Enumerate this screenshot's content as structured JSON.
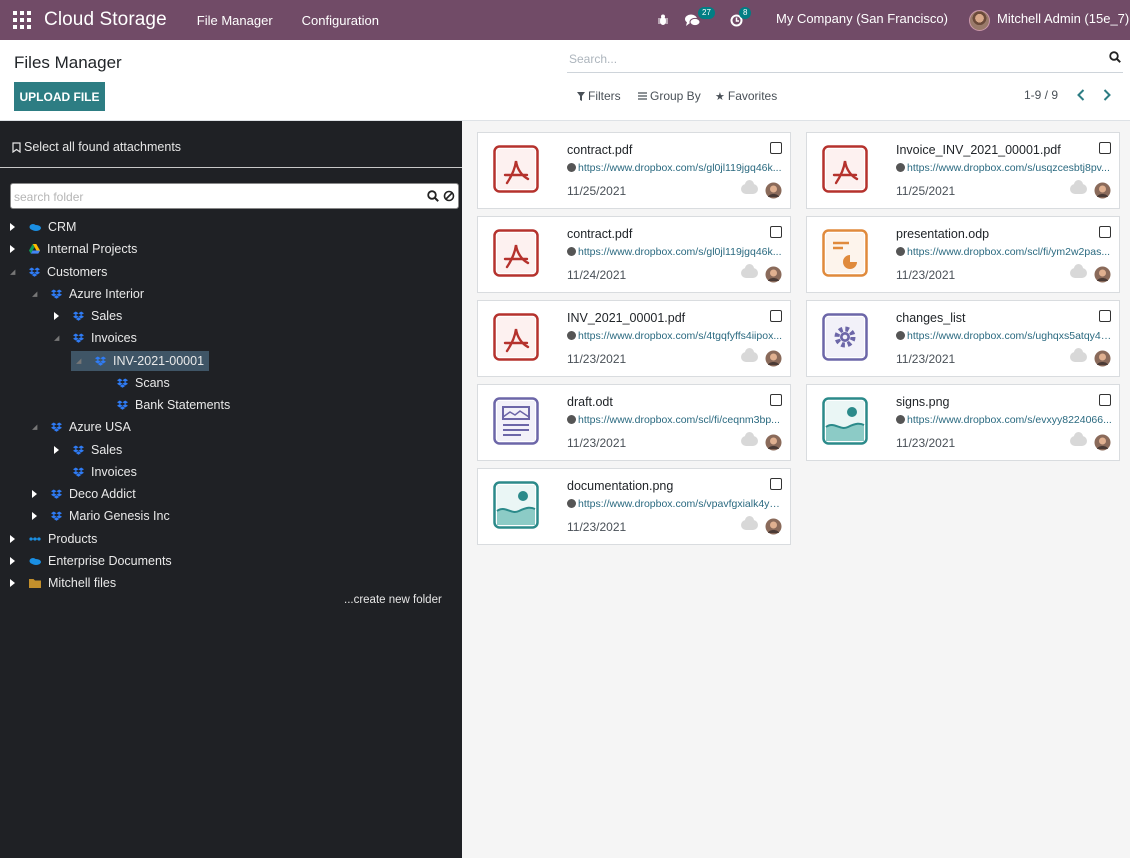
{
  "topbar": {
    "app_title": "Cloud Storage",
    "menu": [
      "File Manager",
      "Configuration"
    ],
    "messages_count": "27",
    "activities_count": "8",
    "company": "My Company (San Francisco)",
    "user": "Mitchell Admin (15e_7)",
    "bg_color": "#714b67"
  },
  "control_panel": {
    "title": "Files Manager",
    "upload_label": "UPLOAD FILE",
    "search_placeholder": "Search...",
    "filters": "Filters",
    "group_by": "Group By",
    "favorites": "Favorites",
    "pager": "1-9 / 9"
  },
  "sidebar": {
    "select_all": "Select all found attachments",
    "search_placeholder": "search folder",
    "create_folder": "...create new folder",
    "tree": [
      {
        "label": "CRM",
        "level": 0,
        "toggle": "collapsed",
        "icon": "onedrive-icon"
      },
      {
        "label": "Internal Projects",
        "level": 0,
        "toggle": "collapsed",
        "icon": "google-drive-icon"
      },
      {
        "label": "Customers",
        "level": 0,
        "toggle": "expanded",
        "icon": "dropbox-icon"
      },
      {
        "label": "Azure Interior",
        "level": 1,
        "toggle": "expanded",
        "icon": "dropbox-icon"
      },
      {
        "label": "Sales",
        "level": 2,
        "toggle": "collapsed",
        "icon": "dropbox-icon"
      },
      {
        "label": "Invoices",
        "level": 2,
        "toggle": "expanded",
        "icon": "dropbox-icon"
      },
      {
        "label": "INV-2021-00001",
        "level": 3,
        "toggle": "expanded",
        "icon": "dropbox-icon",
        "selected": true
      },
      {
        "label": "Scans",
        "level": 4,
        "toggle": "none",
        "icon": "dropbox-icon"
      },
      {
        "label": "Bank Statements",
        "level": 4,
        "toggle": "none",
        "icon": "dropbox-icon"
      },
      {
        "label": "Azure USA",
        "level": 1,
        "toggle": "expanded",
        "icon": "dropbox-icon"
      },
      {
        "label": "Sales",
        "level": 2,
        "toggle": "collapsed",
        "icon": "dropbox-icon"
      },
      {
        "label": "Invoices",
        "level": 2,
        "toggle": "none",
        "icon": "dropbox-icon"
      },
      {
        "label": "Deco Addict",
        "level": 1,
        "toggle": "collapsed",
        "icon": "dropbox-icon"
      },
      {
        "label": "Mario Genesis Inc",
        "level": 1,
        "toggle": "collapsed",
        "icon": "dropbox-icon"
      },
      {
        "label": "Products",
        "level": 0,
        "toggle": "collapsed",
        "icon": "sharepoint-icon"
      },
      {
        "label": "Enterprise Documents",
        "level": 0,
        "toggle": "collapsed",
        "icon": "onedrive-icon"
      },
      {
        "label": "Mitchell files",
        "level": 0,
        "toggle": "collapsed",
        "icon": "folder-icon"
      }
    ]
  },
  "files": [
    {
      "name": "contract.pdf",
      "url": "https://www.dropbox.com/s/gl0jl119jgq46k...",
      "date": "11/25/2021",
      "type": "pdf"
    },
    {
      "name": "Invoice_INV_2021_00001.pdf",
      "url": "https://www.dropbox.com/s/usqzcesbtj8pv...",
      "date": "11/25/2021",
      "type": "pdf"
    },
    {
      "name": "contract.pdf",
      "url": "https://www.dropbox.com/s/gl0jl119jgq46k...",
      "date": "11/24/2021",
      "type": "pdf"
    },
    {
      "name": "presentation.odp",
      "url": "https://www.dropbox.com/scl/fi/ym2w2pas...",
      "date": "11/23/2021",
      "type": "presentation"
    },
    {
      "name": "INV_2021_00001.pdf",
      "url": "https://www.dropbox.com/s/4tgqfyffs4iipox...",
      "date": "11/23/2021",
      "type": "pdf"
    },
    {
      "name": "changes_list",
      "url": "https://www.dropbox.com/s/ughqxs5atqy4c...",
      "date": "11/23/2021",
      "type": "binary"
    },
    {
      "name": "draft.odt",
      "url": "https://www.dropbox.com/scl/fi/ceqnm3bp...",
      "date": "11/23/2021",
      "type": "document"
    },
    {
      "name": "signs.png",
      "url": "https://www.dropbox.com/s/evxyy8224066...",
      "date": "11/23/2021",
      "type": "image"
    },
    {
      "name": "documentation.png",
      "url": "https://www.dropbox.com/s/vpavfgxialk4yk...",
      "date": "11/23/2021",
      "type": "image"
    }
  ]
}
